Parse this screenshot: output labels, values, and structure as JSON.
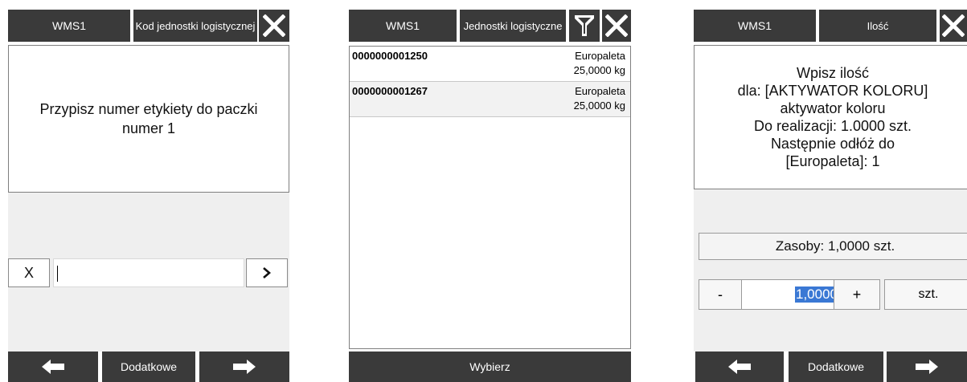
{
  "screen1": {
    "header": {
      "title": "WMS1",
      "subtitle": "Kod jednostki logistycznej"
    },
    "message": "Przypisz numer etykiety do paczki numer 1",
    "input": {
      "clear_label": "X",
      "value": ""
    },
    "footer": {
      "middle_label": "Dodatkowe"
    }
  },
  "screen2": {
    "header": {
      "title": "WMS1",
      "subtitle": "Jednostki logistyczne"
    },
    "items": [
      {
        "code": "0000000001250",
        "type": "Europaleta",
        "weight": "25,0000 kg"
      },
      {
        "code": "0000000001267",
        "type": "Europaleta",
        "weight": "25,0000 kg"
      }
    ],
    "footer": {
      "select_label": "Wybierz"
    }
  },
  "screen3": {
    "header": {
      "title": "WMS1",
      "subtitle": "Ilość"
    },
    "message_lines": [
      "Wpisz ilość",
      "dla: [AKTYWATOR KOLORU]",
      "aktywator koloru",
      "Do realizacji: 1.0000 szt.",
      "Następnie odłóż do",
      "[Europaleta]: 1"
    ],
    "stock": "Zasoby: 1,0000 szt.",
    "quantity": {
      "minus_label": "-",
      "value": "1,0000",
      "plus_label": "+",
      "unit": "szt."
    },
    "footer": {
      "middle_label": "Dodatkowe"
    }
  },
  "icons": {
    "close": "close-icon",
    "filter": "filter-icon",
    "back": "arrow-left-icon",
    "forward": "arrow-right-icon",
    "go": "chevron-right-icon"
  },
  "colors": {
    "header_bg": "#3a3a3a",
    "panel_bg": "#efefef",
    "selection": "#3a78d4"
  }
}
